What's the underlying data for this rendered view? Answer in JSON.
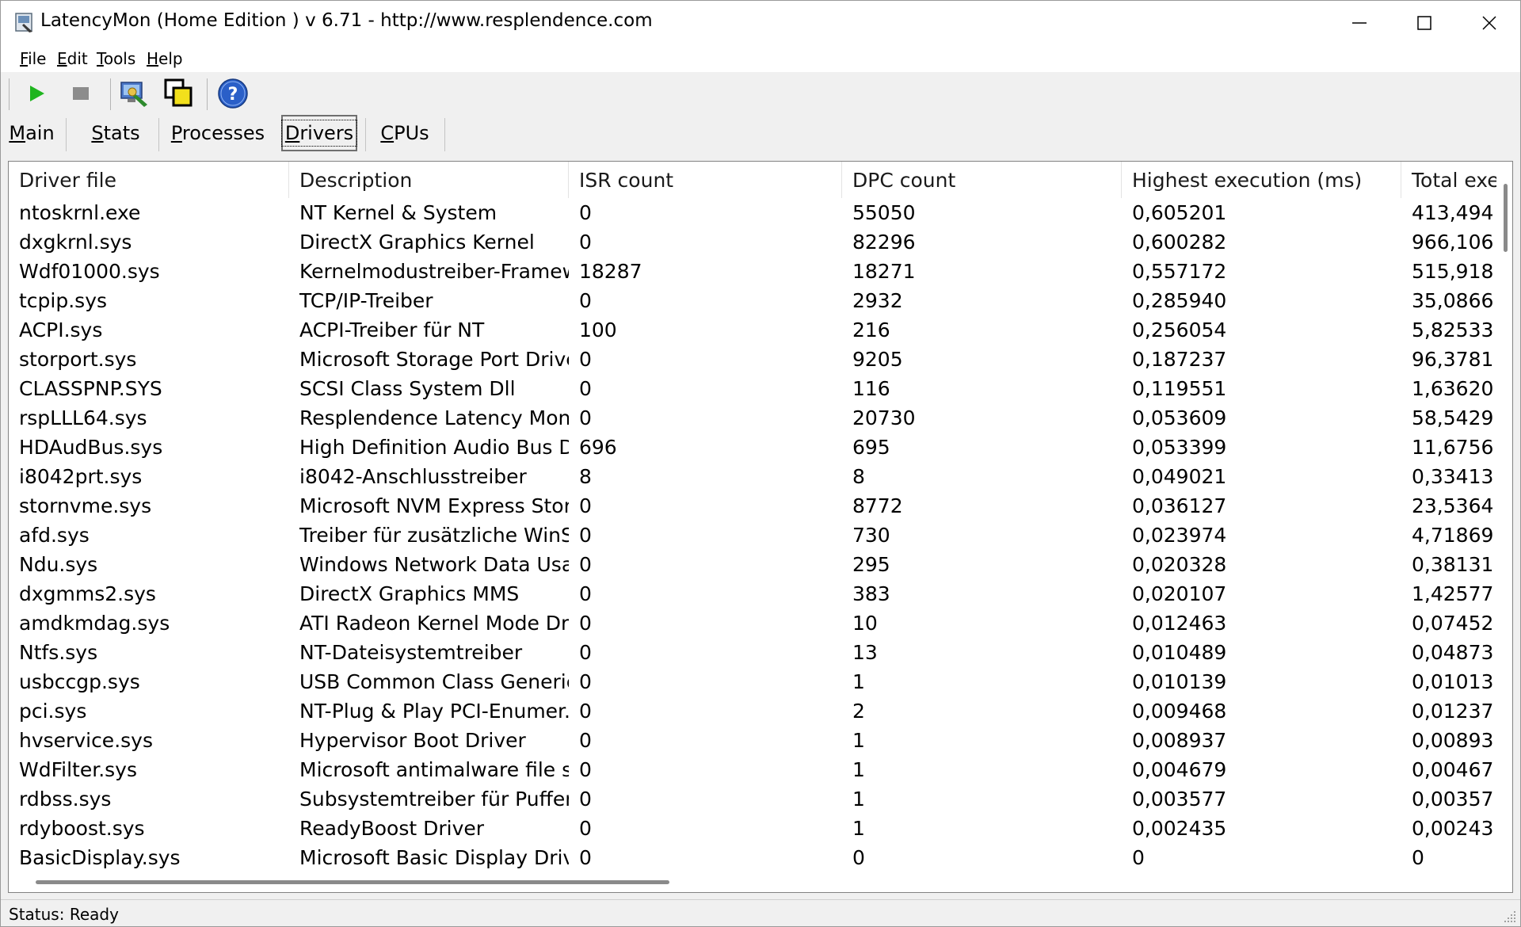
{
  "window": {
    "title": "LatencyMon  (Home Edition )  v 6.71 - http://www.resplendence.com"
  },
  "menu": [
    {
      "accel": "F",
      "rest": "ile"
    },
    {
      "accel": "E",
      "rest": "dit"
    },
    {
      "accel": "T",
      "rest": "ools"
    },
    {
      "accel": "H",
      "rest": "elp"
    }
  ],
  "toolbar": {
    "icons": [
      "play-icon",
      "stop-icon",
      "hardware-inspect-icon",
      "windows-icon",
      "help-icon"
    ],
    "colors": {
      "play": "#1fb51f",
      "stop": "#8c8c8c",
      "help": "#2a5fc8"
    }
  },
  "tabs": [
    {
      "accel": "M",
      "rest": "ain"
    },
    {
      "accel": "S",
      "rest": "tats"
    },
    {
      "accel": "P",
      "rest": "rocesses"
    },
    {
      "accel": "D",
      "rest": "rivers"
    },
    {
      "accel": "C",
      "rest": "PUs"
    }
  ],
  "active_tab": "Drivers",
  "table": {
    "columns": [
      "Driver file",
      "Description",
      "ISR count",
      "DPC count",
      "Highest execution (ms)",
      "Total execution"
    ],
    "rows": [
      [
        "ntoskrnl.exe",
        "NT Kernel & System",
        "0",
        "55050",
        "0,605201",
        "413,494"
      ],
      [
        "dxgkrnl.sys",
        "DirectX Graphics Kernel",
        "0",
        "82296",
        "0,600282",
        "966,106"
      ],
      [
        "Wdf01000.sys",
        "Kernelmodustreiber-Framew...",
        "18287",
        "18271",
        "0,557172",
        "515,918"
      ],
      [
        "tcpip.sys",
        "TCP/IP-Treiber",
        "0",
        "2932",
        "0,285940",
        "35,0866"
      ],
      [
        "ACPI.sys",
        "ACPI-Treiber für NT",
        "100",
        "216",
        "0,256054",
        "5,82533"
      ],
      [
        "storport.sys",
        "Microsoft Storage Port Driver",
        "0",
        "9205",
        "0,187237",
        "96,3781"
      ],
      [
        "CLASSPNP.SYS",
        "SCSI Class System Dll",
        "0",
        "116",
        "0,119551",
        "1,63620"
      ],
      [
        "rspLLL64.sys",
        "Resplendence Latency Monit...",
        "0",
        "20730",
        "0,053609",
        "58,5429"
      ],
      [
        "HDAudBus.sys",
        "High Definition Audio Bus Dri...",
        "696",
        "695",
        "0,053399",
        "11,6756"
      ],
      [
        "i8042prt.sys",
        "i8042-Anschlusstreiber",
        "8",
        "8",
        "0,049021",
        "0,33413"
      ],
      [
        "stornvme.sys",
        "Microsoft NVM Express Stor...",
        "0",
        "8772",
        "0,036127",
        "23,5364"
      ],
      [
        "afd.sys",
        "Treiber für zusätzliche WinS...",
        "0",
        "730",
        "0,023974",
        "4,71869"
      ],
      [
        "Ndu.sys",
        "Windows Network Data Usa...",
        "0",
        "295",
        "0,020328",
        "0,38131"
      ],
      [
        "dxgmms2.sys",
        "DirectX Graphics MMS",
        "0",
        "383",
        "0,020107",
        "1,42577"
      ],
      [
        "amdkmdag.sys",
        "ATI Radeon Kernel Mode Dri...",
        "0",
        "10",
        "0,012463",
        "0,07452"
      ],
      [
        "Ntfs.sys",
        "NT-Dateisystemtreiber",
        "0",
        "13",
        "0,010489",
        "0,04873"
      ],
      [
        "usbccgp.sys",
        "USB Common Class Generic ...",
        "0",
        "1",
        "0,010139",
        "0,01013"
      ],
      [
        "pci.sys",
        "NT-Plug & Play PCI-Enumer...",
        "0",
        "2",
        "0,009468",
        "0,01237"
      ],
      [
        "hvservice.sys",
        "Hypervisor Boot Driver",
        "0",
        "1",
        "0,008937",
        "0,00893"
      ],
      [
        "WdFilter.sys",
        "Microsoft antimalware file sys...",
        "0",
        "1",
        "0,004679",
        "0,00467"
      ],
      [
        "rdbss.sys",
        "Subsystemtreiber für Puffer...",
        "0",
        "1",
        "0,003577",
        "0,00357"
      ],
      [
        "rdyboost.sys",
        "ReadyBoost Driver",
        "0",
        "1",
        "0,002435",
        "0,00243"
      ],
      [
        "BasicDisplay.sys",
        "Microsoft Basic Display Driver",
        "0",
        "0",
        "0",
        "0"
      ]
    ]
  },
  "status": {
    "text": "Status: Ready"
  }
}
